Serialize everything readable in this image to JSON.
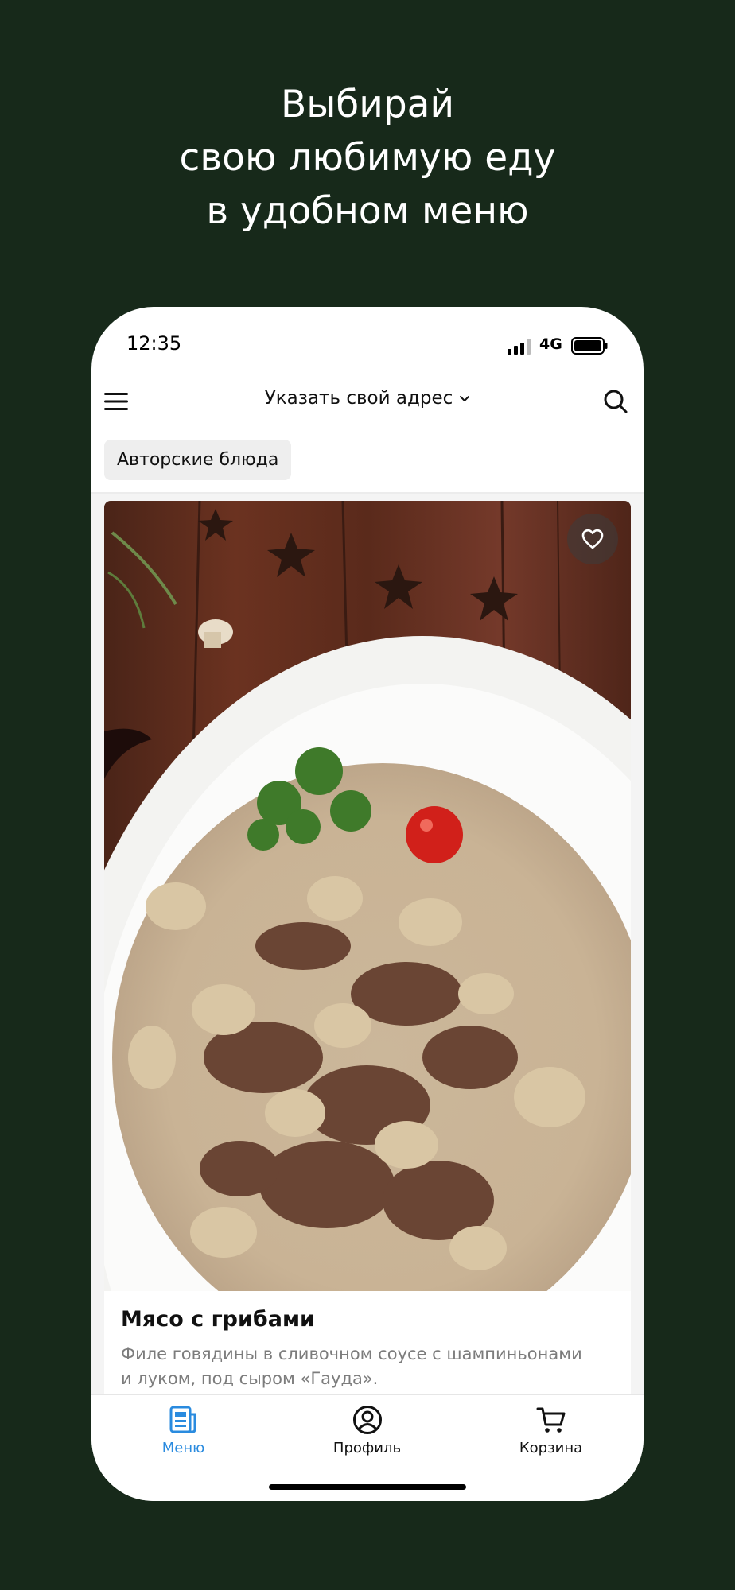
{
  "promo": {
    "headline_line1": "Выбирай",
    "headline_line2": "свою любимую еду",
    "headline_line3": "в удобном меню"
  },
  "status_bar": {
    "time": "12:35",
    "network": "4G",
    "icons": [
      "signal-icon",
      "battery-icon"
    ]
  },
  "header": {
    "menu_icon": "hamburger-menu-icon",
    "address_label": "Указать свой адрес",
    "search_icon": "search-icon"
  },
  "category": {
    "label": "Авторские блюда"
  },
  "dish": {
    "title": "Мясо с грибами",
    "description": "Филе говядины в сливочном соусе с шампиньонами и луком, под сыром «Гауда».",
    "favorite_icon": "heart-icon"
  },
  "tabs": [
    {
      "label": "Меню",
      "icon": "menu-document-icon",
      "active": true
    },
    {
      "label": "Профиль",
      "icon": "profile-icon",
      "active": false
    },
    {
      "label": "Корзина",
      "icon": "cart-icon",
      "active": false
    }
  ],
  "colors": {
    "background": "#17291a",
    "accent": "#2a8bdf",
    "text_primary": "#111111",
    "text_secondary": "#7c7c7c"
  }
}
